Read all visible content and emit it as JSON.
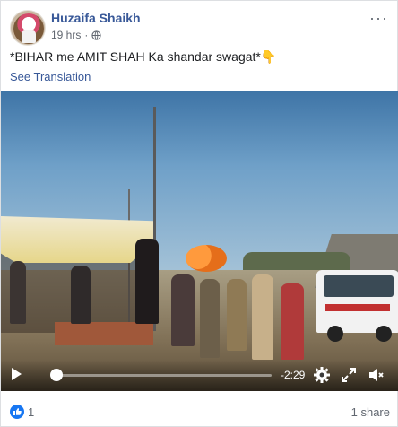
{
  "post": {
    "author": "Huzaifa Shaikh",
    "time": "19 hrs",
    "separator": "·",
    "caption": "*BIHAR me AMIT SHAH Ka shandar swagat*👇",
    "see_translation": "See Translation"
  },
  "video": {
    "time_remaining": "-2:29",
    "progress": 0.0
  },
  "footer": {
    "like_count": "1",
    "share_count": "1 share"
  },
  "colors": {
    "link": "#385898",
    "like_blue": "#1877f2",
    "meta_grey": "#616770"
  },
  "icons": {
    "privacy": "globe-icon",
    "options": "more-options-icon",
    "play": "play-icon",
    "settings": "gear-icon",
    "fullscreen": "expand-icon",
    "volume": "volume-icon",
    "reaction": "like-thumb-icon"
  }
}
